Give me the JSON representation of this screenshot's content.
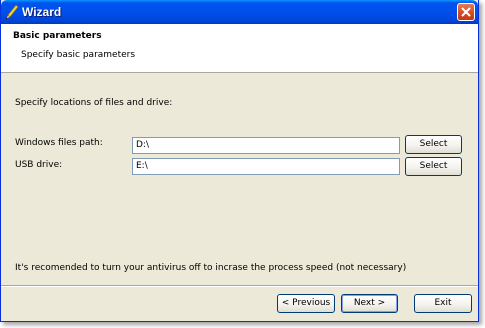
{
  "window": {
    "title": "Wizard"
  },
  "header": {
    "title": "Basic parameters",
    "subtitle": "Specify basic parameters"
  },
  "main": {
    "instructions": "Specify locations of files and drive:",
    "windows_path": {
      "label": "Windows files path:",
      "value": "D:\\",
      "select_label": "Select"
    },
    "usb_drive": {
      "label": "USB drive:",
      "value": "E:\\",
      "select_label": "Select"
    },
    "note": "It's recomended to turn your antivirus off to incrase the process speed (not necessary)"
  },
  "footer": {
    "previous_label": "< Previous",
    "next_label": "Next >",
    "exit_label": "Exit"
  },
  "colors": {
    "titlebar": "#0053ee",
    "window_bg": "#ece9d8",
    "close_button": "#d2491f",
    "field_border": "#7f9db9"
  },
  "icons": {
    "app": "pen-icon",
    "close": "close-icon"
  }
}
